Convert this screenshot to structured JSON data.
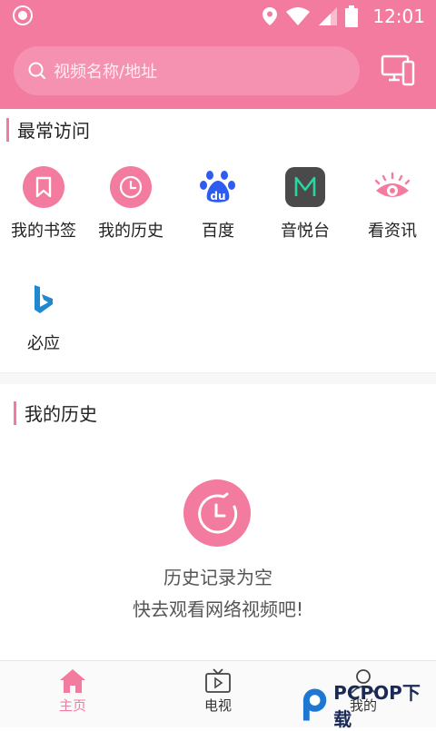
{
  "status": {
    "time": "12:01"
  },
  "search": {
    "placeholder": "视频名称/地址"
  },
  "frequent": {
    "title": "最常访问",
    "items": [
      {
        "label": "我的书签",
        "icon": "bookmark-icon"
      },
      {
        "label": "我的历史",
        "icon": "clock-icon"
      },
      {
        "label": "百度",
        "icon": "baidu-paw-icon"
      },
      {
        "label": "音悦台",
        "icon": "yinyuetai-m-icon"
      },
      {
        "label": "看资讯",
        "icon": "eye-icon"
      },
      {
        "label": "必应",
        "icon": "bing-icon"
      }
    ]
  },
  "history": {
    "title": "我的历史",
    "empty_line1": "历史记录为空",
    "empty_line2": "快去观看网络视频吧!"
  },
  "tabs": [
    {
      "label": "主页",
      "icon": "home-icon",
      "active": true
    },
    {
      "label": "电视",
      "icon": "tv-icon",
      "active": false
    },
    {
      "label": "我的",
      "icon": "person-icon",
      "active": false
    }
  ],
  "watermark": {
    "text": "PCPOP下载"
  },
  "colors": {
    "accent": "#f47ba0",
    "baidu": "#2e5bf0",
    "yinyuetai_bg": "#4a4a4a",
    "yinyuetai_m": "#28d7a0",
    "bing": "#1e88d2"
  }
}
